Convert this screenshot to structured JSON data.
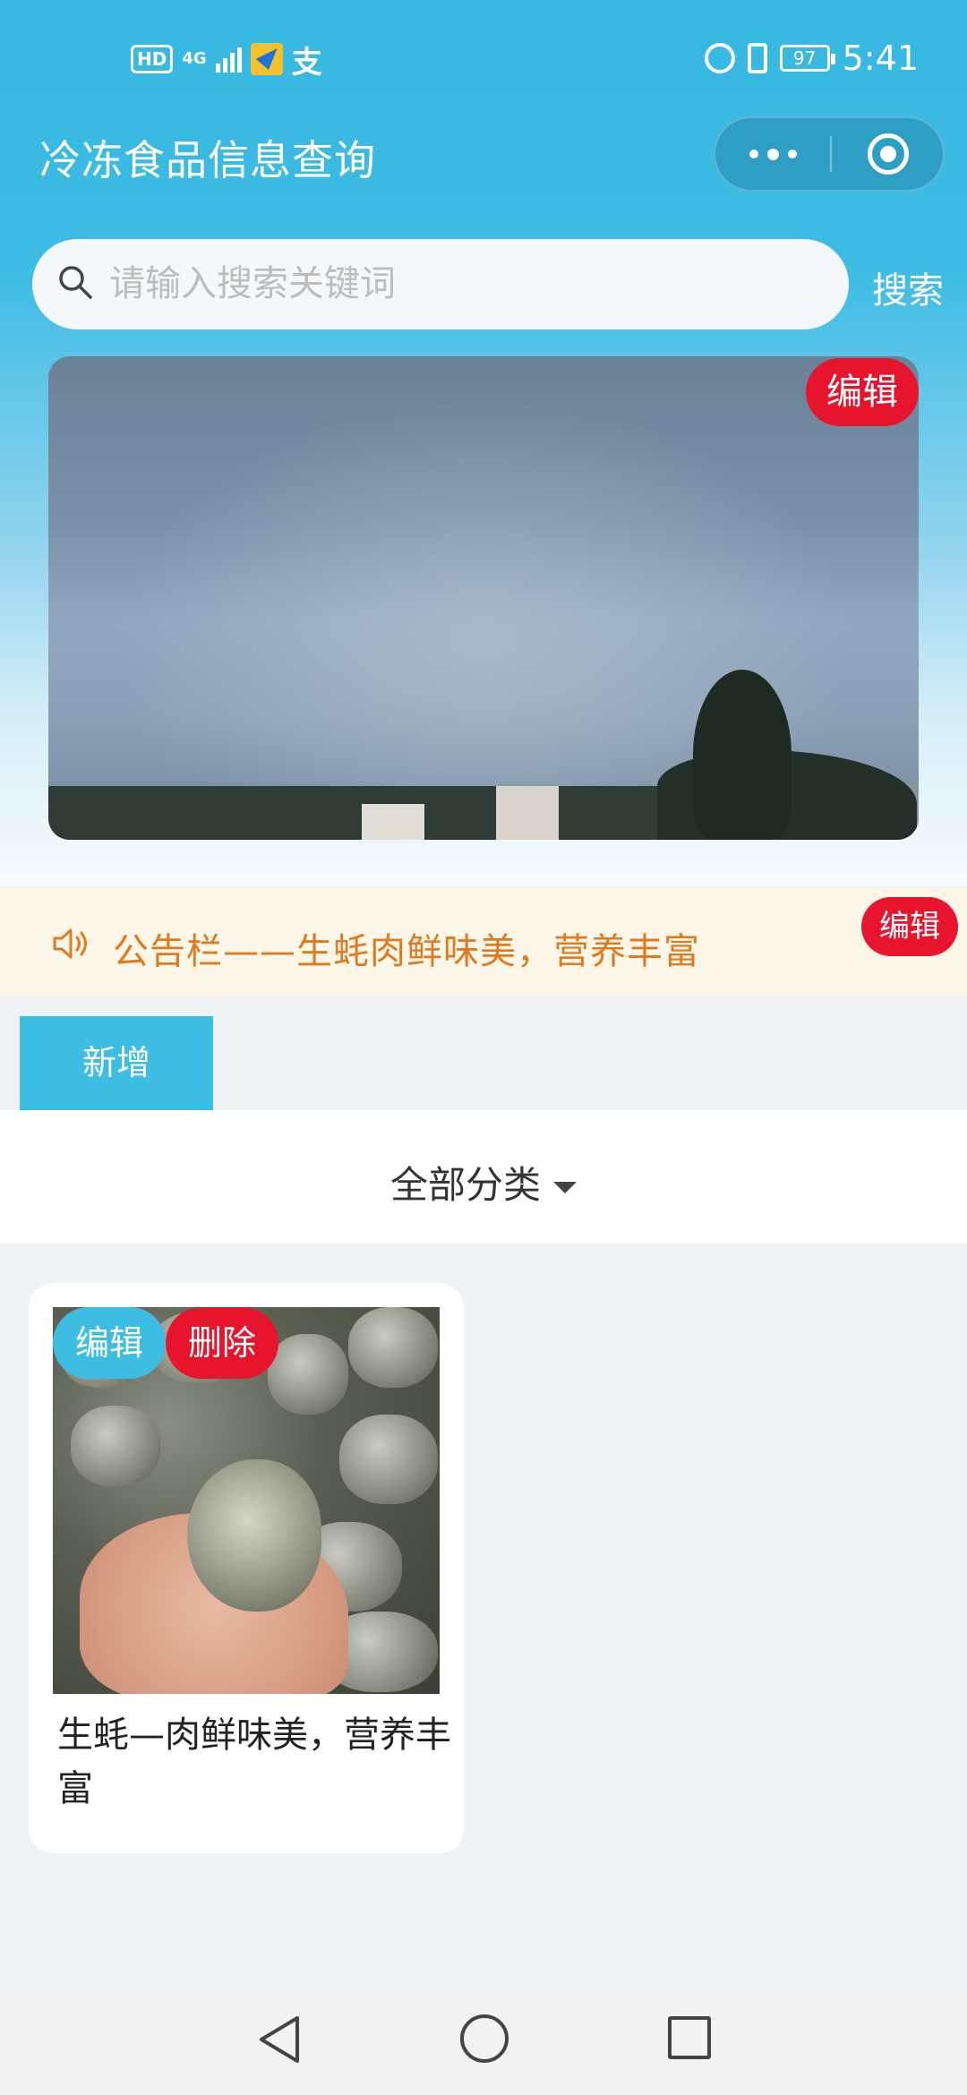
{
  "status_bar": {
    "hd": "HD",
    "network": "4G",
    "pay_glyph": "支",
    "battery": "97",
    "time": "5:41"
  },
  "header": {
    "title": "冷冻食品信息查询",
    "more_icon": "more-dots-icon",
    "close_icon": "target-icon"
  },
  "search": {
    "placeholder": "请输入搜索关键词",
    "value": "",
    "button_label": "搜索"
  },
  "banner": {
    "edit_label": "编辑"
  },
  "notice": {
    "text": "公告栏——生蚝肉鲜味美，营养丰富",
    "edit_label": "编辑",
    "icon": "speaker-icon"
  },
  "toolbar": {
    "add_label": "新增"
  },
  "category": {
    "selected": "全部分类"
  },
  "products": [
    {
      "title": "生蚝—肉鲜味美，营养丰富",
      "edit_label": "编辑",
      "delete_label": "删除"
    }
  ],
  "colors": {
    "primary": "#3ebde3",
    "danger": "#e6152d",
    "notice_text": "#e07a1f",
    "notice_bg": "#fdf7e9"
  }
}
